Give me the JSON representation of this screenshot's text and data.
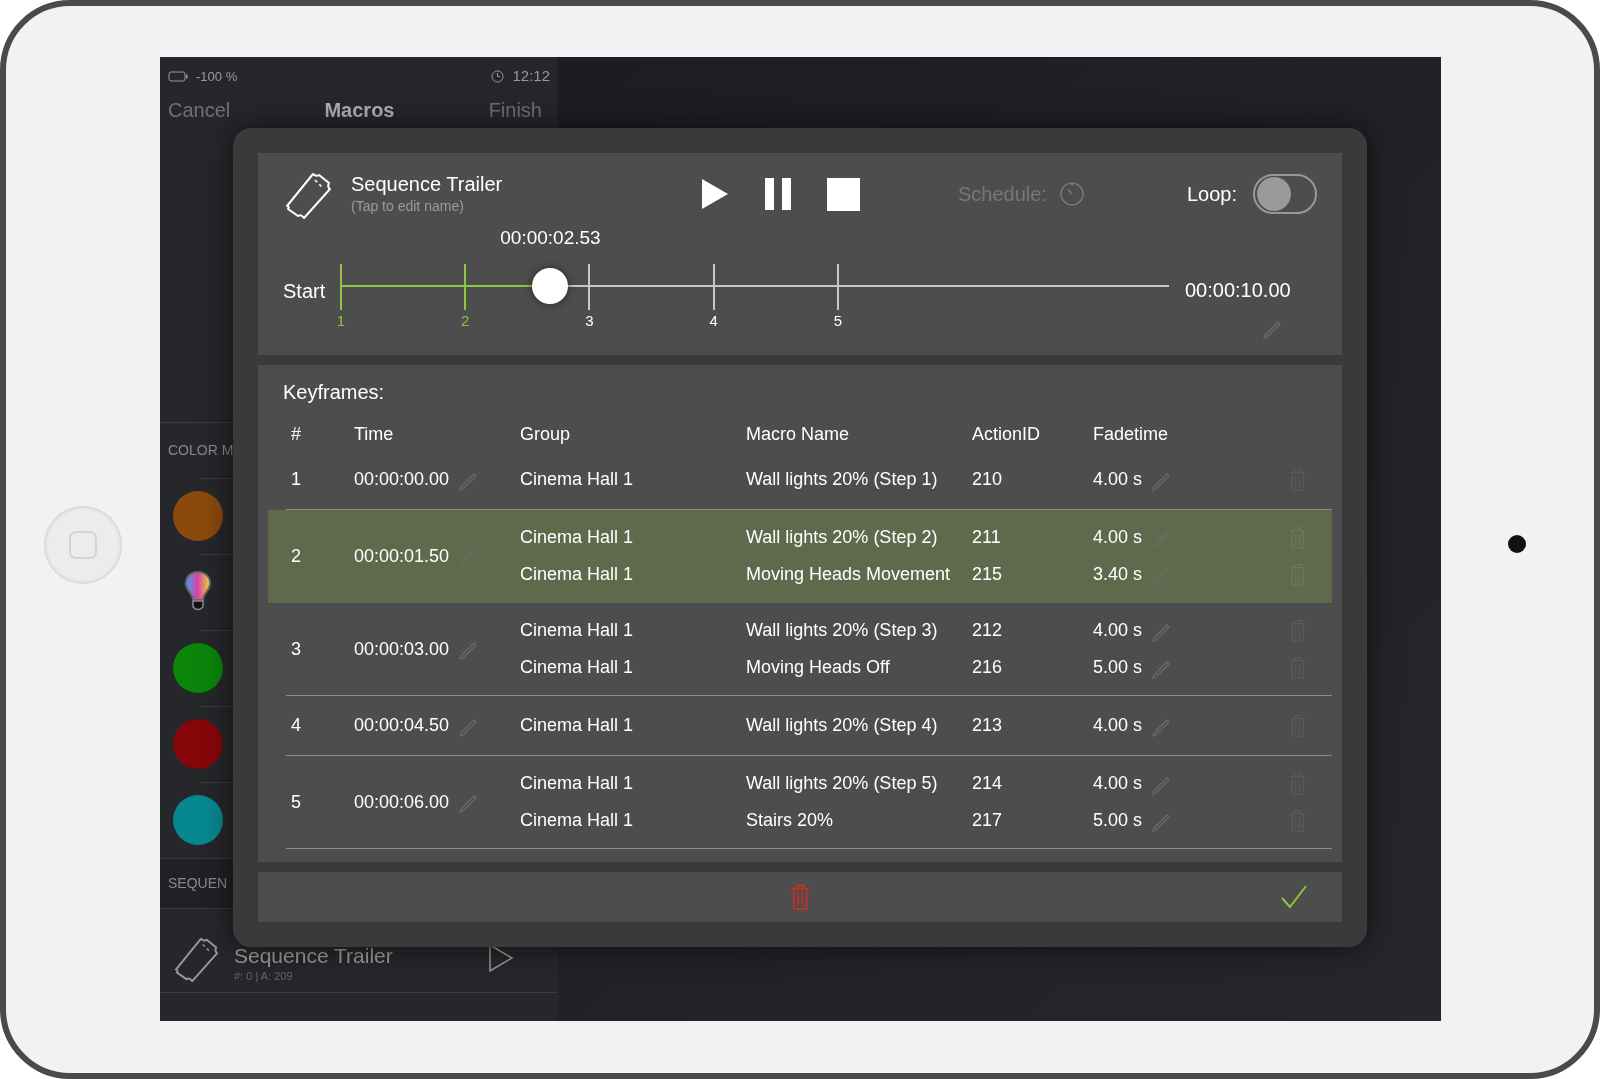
{
  "status_bar": {
    "battery": "-100 %",
    "time": "12:12"
  },
  "nav": {
    "left": "Cancel",
    "title": "Macros",
    "right": "Finish"
  },
  "sidebar": {
    "sections": [
      {
        "label": "COLOR M"
      },
      {
        "label": "SEQUEN"
      }
    ],
    "colors": [
      {
        "kind": "swatch",
        "color": "#8a4a0c"
      },
      {
        "kind": "bulb"
      },
      {
        "kind": "swatch",
        "color": "#0a850a"
      },
      {
        "kind": "swatch",
        "color": "#850709"
      },
      {
        "kind": "swatch",
        "color": "#078890"
      }
    ],
    "sequence": {
      "name": "Sequence Trailer",
      "meta": "#: 0 | A: 209"
    }
  },
  "dialog": {
    "name": "Sequence Trailer",
    "hint": "(Tap to edit name)",
    "schedule": "Schedule:",
    "loop": {
      "label": "Loop:",
      "on": false
    },
    "timeline": {
      "markers": [
        "1",
        "2",
        "3",
        "4",
        "5"
      ],
      "start": "Start",
      "position": "00:00:02.53",
      "end": "00:00:10.00",
      "level": 0.253
    },
    "keyframes_title": "Keyframes:",
    "columns": [
      "#",
      "Time",
      "Group",
      "Macro Name",
      "ActionID",
      "Fadetime"
    ],
    "rows": [
      {
        "number": "1",
        "time": "00:00:00.00",
        "selected": false,
        "entries": [
          {
            "group": "Cinema Hall 1",
            "macro": "Wall lights 20% (Step 1)",
            "action_id": "210",
            "fadetime": "4.00 s"
          }
        ]
      },
      {
        "number": "2",
        "time": "00:00:01.50",
        "selected": true,
        "entries": [
          {
            "group": "Cinema Hall 1",
            "macro": "Wall lights 20% (Step 2)",
            "action_id": "211",
            "fadetime": "4.00 s"
          },
          {
            "group": "Cinema Hall 1",
            "macro": "Moving Heads Movement",
            "action_id": "215",
            "fadetime": "3.40 s"
          }
        ]
      },
      {
        "number": "3",
        "time": "00:00:03.00",
        "selected": false,
        "entries": [
          {
            "group": "Cinema Hall 1",
            "macro": "Wall lights 20% (Step 3)",
            "action_id": "212",
            "fadetime": "4.00 s"
          },
          {
            "group": "Cinema Hall 1",
            "macro": "Moving Heads Off",
            "action_id": "216",
            "fadetime": "5.00 s"
          }
        ]
      },
      {
        "number": "4",
        "time": "00:00:04.50",
        "selected": false,
        "entries": [
          {
            "group": "Cinema Hall 1",
            "macro": "Wall lights 20% (Step 4)",
            "action_id": "213",
            "fadetime": "4.00 s"
          }
        ]
      },
      {
        "number": "5",
        "time": "00:00:06.00",
        "selected": false,
        "entries": [
          {
            "group": "Cinema Hall 1",
            "macro": "Wall lights 20% (Step 5)",
            "action_id": "214",
            "fadetime": "4.00 s"
          },
          {
            "group": "Cinema Hall 1",
            "macro": "Stairs 20%",
            "action_id": "217",
            "fadetime": "5.00 s"
          }
        ]
      }
    ]
  }
}
